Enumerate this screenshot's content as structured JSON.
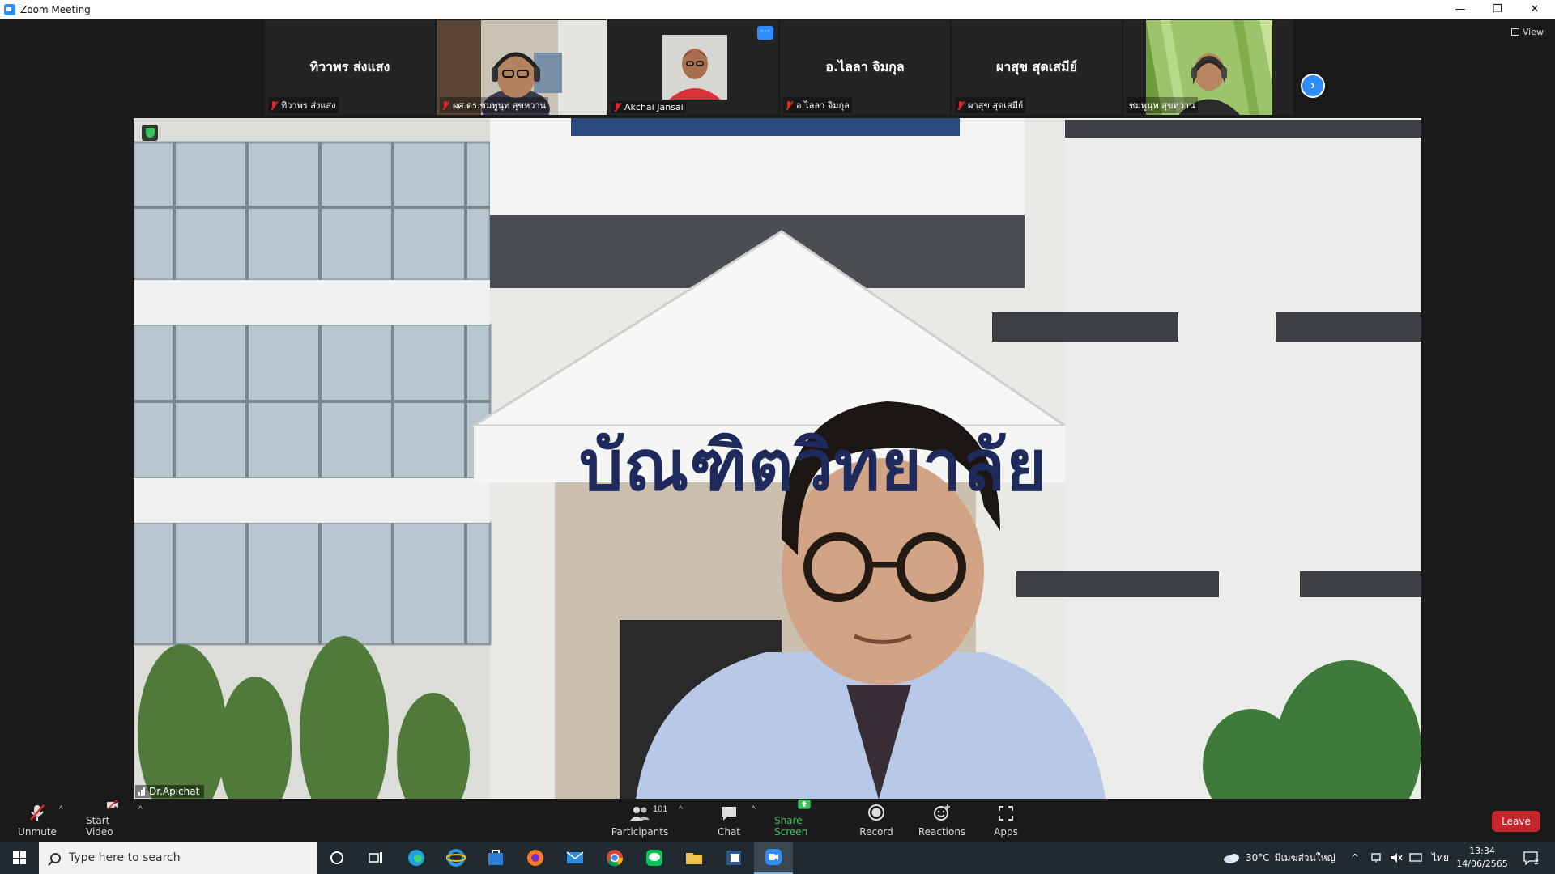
{
  "window": {
    "title": "Zoom Meeting",
    "minimize": "—",
    "restore": "❐",
    "close": "✕"
  },
  "view_button": {
    "label": "View"
  },
  "strip": {
    "tiles": [
      {
        "big_name": "ทิวาพร ส่งแสง",
        "label": "ทิวาพร ส่งแสง"
      },
      {
        "big_name": "",
        "label": "ผศ.ดร.ชมพูนุท สุขหวาน"
      },
      {
        "big_name": "",
        "label": "Akchai Jansai",
        "more": "···"
      },
      {
        "big_name": "อ.ไลลา จิมกุล",
        "label": "อ.ไลลา จิมกุล"
      },
      {
        "big_name": "ผาสุข สุดเสมีย์",
        "label": "ผาสุข สุดเสมีย์"
      },
      {
        "big_name": "",
        "label": "ชมพูนุท สุขหวาน"
      }
    ],
    "next": "›"
  },
  "main_video": {
    "speaker": "Dr.Apichat",
    "sign_text": "บัณฑิตวิทยาลัย"
  },
  "toolbar": {
    "unmute": "Unmute",
    "start_video": "Start Video",
    "participants": "Participants",
    "participants_count": "101",
    "chat": "Chat",
    "share_screen": "Share Screen",
    "record": "Record",
    "reactions": "Reactions",
    "apps": "Apps",
    "leave": "Leave",
    "caret": "^"
  },
  "taskbar": {
    "search_placeholder": "Type here to search",
    "weather": "30°C",
    "weather_desc": "มีเมฆส่วนใหญ่",
    "lang": "ไทย",
    "time": "13:34",
    "date": "14/06/2565",
    "notifications": "2"
  },
  "colors": {
    "zoom_blue": "#2d8cff",
    "leave_red": "#c4262e",
    "share_green": "#3cc25a",
    "mic_off_red": "#e02828"
  }
}
